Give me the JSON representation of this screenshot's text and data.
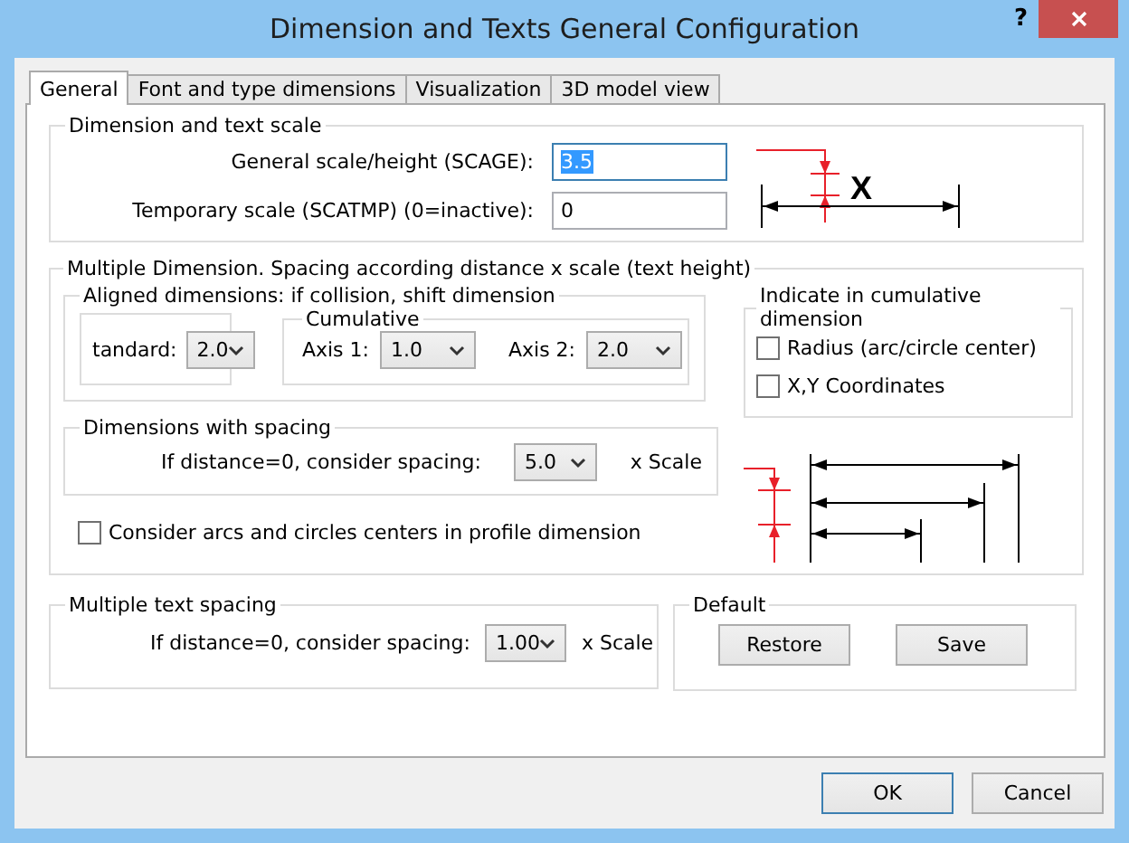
{
  "window": {
    "title": "Dimension and Texts General Configuration",
    "help": "?"
  },
  "tabs": [
    {
      "label": "General",
      "selected": true
    },
    {
      "label": "Font and type dimensions",
      "selected": false
    },
    {
      "label": "Visualization",
      "selected": false
    },
    {
      "label": "3D model view",
      "selected": false
    }
  ],
  "scale_group": {
    "title": "Dimension and text scale",
    "fields": [
      {
        "label": "General scale/height (SCAGE):",
        "value": "3.5",
        "text_selected": true
      },
      {
        "label": "Temporary scale (SCATMP) (0=inactive):",
        "value": "0",
        "text_selected": false
      }
    ],
    "diagram_label": "X"
  },
  "multiple_dimension": {
    "title": "Multiple Dimension. Spacing according  distance x scale (text height)",
    "aligned": {
      "title": "Aligned dimensions: if collision, shift dimension",
      "standard": {
        "label": "tandard:",
        "value": "2.0"
      },
      "cumulative": {
        "title": "Cumulative",
        "axes": [
          {
            "label": "Axis 1:",
            "value": "1.0"
          },
          {
            "label": "Axis 2:",
            "value": "2.0"
          }
        ]
      }
    },
    "indicate": {
      "title": "Indicate in cumulative dimension",
      "options": [
        {
          "label": "Radius (arc/circle center)",
          "checked": false
        },
        {
          "label": "X,Y Coordinates",
          "checked": false
        }
      ]
    },
    "spacing": {
      "title": "Dimensions with spacing",
      "label": "If distance=0, consider spacing:",
      "value": "5.0",
      "unit": "x Scale"
    },
    "arcs_option": {
      "label": "Consider arcs and circles centers in profile dimension",
      "checked": false
    }
  },
  "text_spacing": {
    "title": "Multiple text spacing",
    "label": "If distance=0, consider spacing:",
    "value": "1.00",
    "unit": "x Scale"
  },
  "default_group": {
    "title": "Default",
    "buttons": [
      "Restore",
      "Save"
    ]
  },
  "footer_buttons": [
    {
      "label": "OK",
      "default": true
    },
    {
      "label": "Cancel",
      "default": false
    }
  ]
}
